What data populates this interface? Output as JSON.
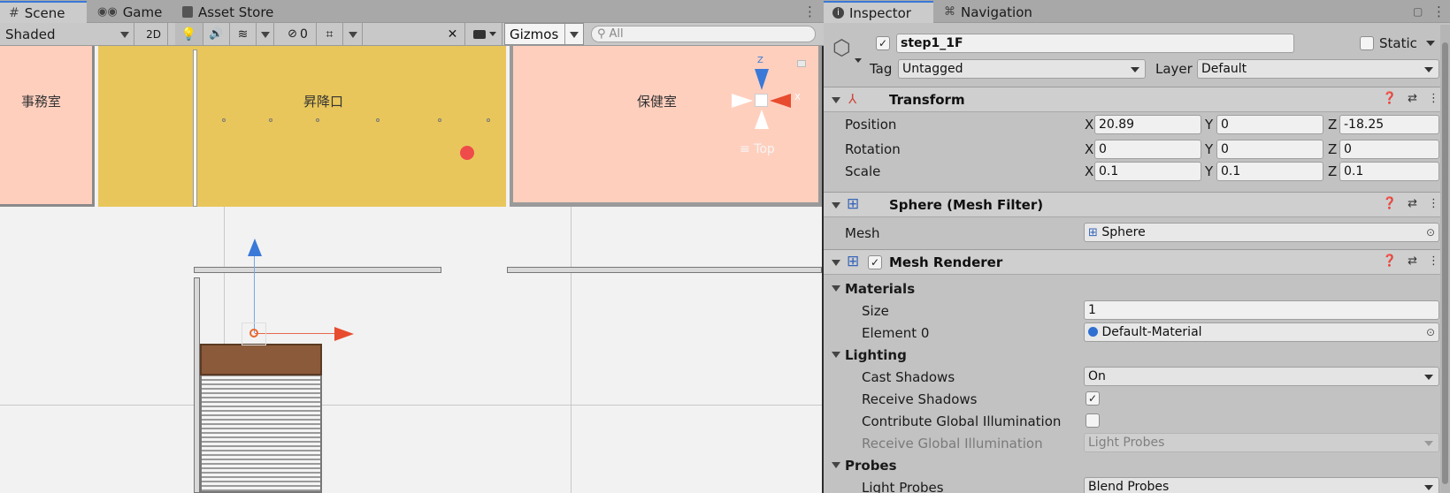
{
  "tabs": {
    "scene": "Scene",
    "game": "Game",
    "asset_store": "Asset Store",
    "inspector": "Inspector",
    "navigation": "Navigation"
  },
  "scene_toolbar": {
    "draw_mode": "Shaded",
    "toggle_2d": "2D",
    "hidden_count": "0",
    "gizmos": "Gizmos",
    "search_placeholder": "All"
  },
  "scene_view": {
    "rooms": [
      "事務室",
      "昇降口",
      "保健室"
    ],
    "orientation_label": "Top",
    "gizmo_axes": {
      "y": "Z",
      "x": "X"
    }
  },
  "inspector": {
    "object_name": "step1_1F",
    "static_label": "Static",
    "tag_label": "Tag",
    "tag_value": "Untagged",
    "layer_label": "Layer",
    "layer_value": "Default",
    "transform": {
      "title": "Transform",
      "position_label": "Position",
      "rotation_label": "Rotation",
      "scale_label": "Scale",
      "position": {
        "x": "20.89",
        "y": "0",
        "z": "-18.25"
      },
      "rotation": {
        "x": "0",
        "y": "0",
        "z": "0"
      },
      "scale": {
        "x": "0.1",
        "y": "0.1",
        "z": "0.1"
      },
      "axis_x": "X",
      "axis_y": "Y",
      "axis_z": "Z"
    },
    "mesh_filter": {
      "title": "Sphere (Mesh Filter)",
      "mesh_label": "Mesh",
      "mesh_value": "Sphere"
    },
    "mesh_renderer": {
      "title": "Mesh Renderer",
      "materials_label": "Materials",
      "size_label": "Size",
      "size_value": "1",
      "element0_label": "Element 0",
      "element0_value": "Default-Material",
      "lighting_label": "Lighting",
      "cast_shadows_label": "Cast Shadows",
      "cast_shadows_value": "On",
      "receive_shadows_label": "Receive Shadows",
      "contribute_gi_label": "Contribute Global Illumination",
      "receive_gi_label": "Receive Global Illumination",
      "receive_gi_value": "Light Probes",
      "probes_label": "Probes",
      "light_probes_label": "Light Probes",
      "light_probes_value": "Blend Probes"
    }
  },
  "colors": {
    "accent": "#3a79d7",
    "room_pink": "#ffcfbe",
    "room_yellow": "#e8c65b",
    "floor": "#f2f2f2",
    "panel": "#c2c2c2"
  }
}
